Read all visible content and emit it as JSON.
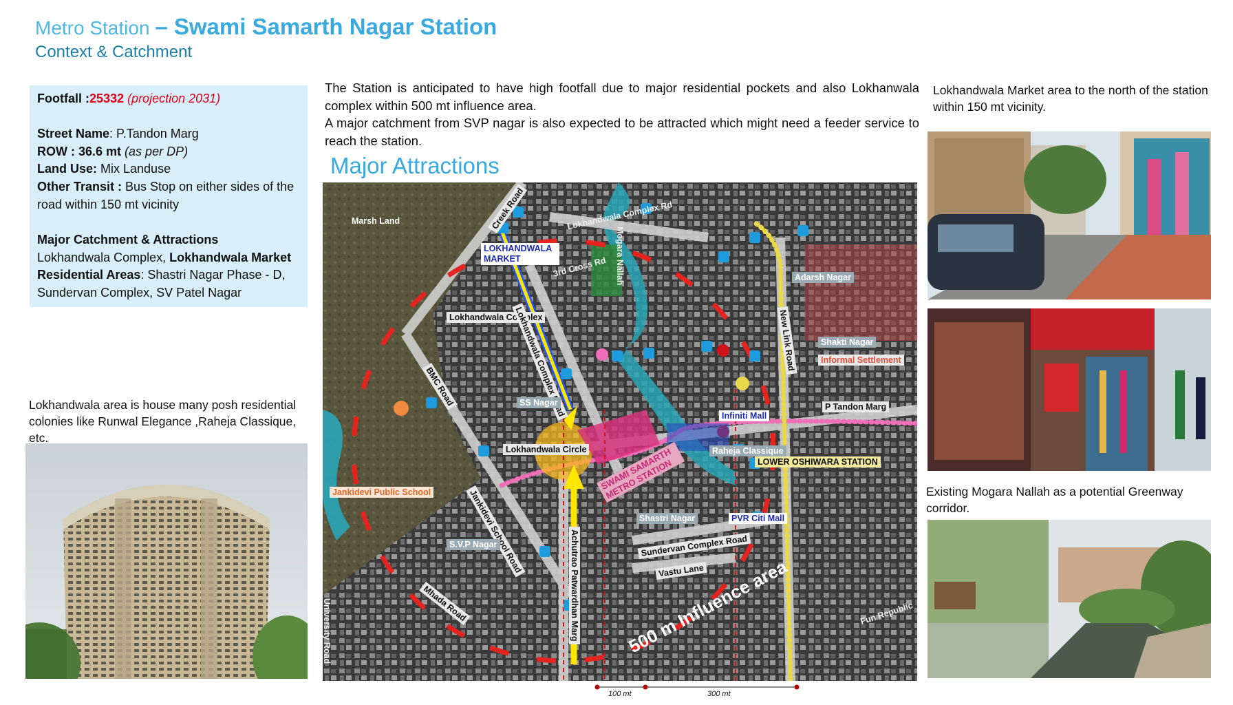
{
  "header": {
    "prefix": "Metro Station",
    "title": "– Swami Samarth Nagar Station",
    "subtitle": "Context & Catchment"
  },
  "info": {
    "footfall_label": "Footfall :",
    "footfall_value": "25332",
    "footfall_note": "(projection 2031)",
    "street_label": "Street Name",
    "street_value": ": P.Tandon  Marg",
    "row_label": "ROW : 36.6  mt",
    "row_note": "(as per DP)",
    "landuse_label": "Land Use:",
    "landuse_value": " Mix Landuse",
    "transit_label": "Other Transit  :",
    "transit_value": " Bus Stop on either sides of the road within 150 mt vicinity",
    "catchment_label": "Major  Catchment & Attractions",
    "catchment_value_a": "Lokhandwala Complex, ",
    "catchment_value_b": "Lokhandwala Market",
    "residential_label": "Residential Areas",
    "residential_value": ": Shastri Nagar Phase - D, Sundervan Complex, SV Patel Nagar"
  },
  "description": [
    "The Station is anticipated to have high footfall due to  major residential pockets and also Lokhanwala complex within 500 mt influence area.",
    "A major catchment from SVP nagar is also expected to be attracted which might need a feeder service to reach the station."
  ],
  "attractions_title": "Major Attractions",
  "captions": {
    "left": "Lokhandwala area is house many posh residential colonies like Runwal Elegance ,Raheja Classique, etc.",
    "right_top": "Lokhandwala Market area to the north of the station within 150 mt vicinity.",
    "right_bottom": "Existing  Mogara Nallah as a potential Greenway corridor."
  },
  "map": {
    "labels": {
      "marsh": "Marsh Land",
      "creek": "Creek Road",
      "lokhandwala_market": "LOKHANDWALA MARKET",
      "lokhandwala_complex_rd_top": "Lokhandwala Complex Rd",
      "mogara": "Mogara Nallah",
      "lord_cross": "3rd Cross Rd",
      "adarsh": "Adarsh Nagar",
      "lokhandwala_complex": "Lokhandwala Complex",
      "lokhandwala_complex_road": "Lokhandwala Complex Road",
      "new_link": "New Link Road",
      "shakti": "Shakti Nagar",
      "informal": "Informal Settlement",
      "bmc": "BMC Road",
      "ss_nagar": "SS Nagar",
      "infiniti": "Infiniti  Mall",
      "p_tandon": "P Tandon Marg",
      "station": "SWAMI SAMARTH METRO STATION",
      "lokhandwala_circle": "Lokhandwala Circle",
      "raheja": "Raheja Classique",
      "lower_oshiwara": "LOWER OSHIWARA STATION",
      "jankidevi_school": "Jankidevi Public School",
      "jankidevi_road": "Jankidevi School Road",
      "pvr": "PVR Citi Mall",
      "shastri": "Shastri Nagar",
      "svp": "S.V.P Nagar",
      "sundervan": "Sundervan Complex Road",
      "vastu": "Vastu Lane",
      "influence": "500 m Influence area",
      "achutrao": "Achutrao Patwardhan Marg",
      "mhada": "Mhada Road",
      "fun_republic": "Fun Republic",
      "university": "University Road"
    },
    "scale": {
      "left": "100 mt",
      "right": "300 mt"
    }
  },
  "colors": {
    "title": "#3aa9dd",
    "subtitle": "#1d7fa8",
    "infobox": "#d8eef8",
    "highlight_red": "#e0001b",
    "influence_ring": "#e52420",
    "arrow": "#ffe600",
    "metro_line": "#f06fb8",
    "water": "#2aa6b6"
  }
}
